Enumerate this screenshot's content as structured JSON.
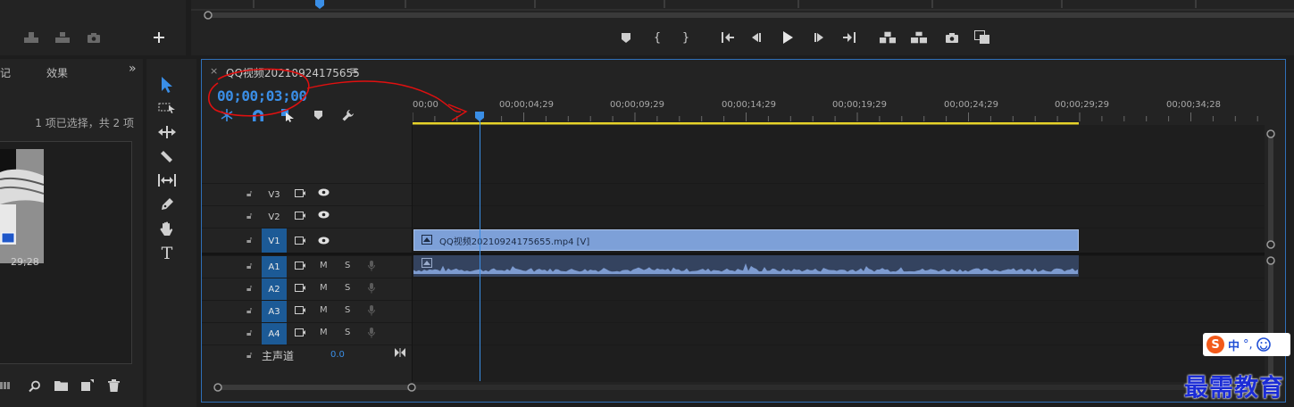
{
  "project_panel": {
    "tab_partial": "记",
    "tab_effects": "效果",
    "expand_glyph": "»",
    "selection_info": "1 项已选择，共 2 项",
    "thumb_duration": "29;28"
  },
  "timeline": {
    "close_glyph": "×",
    "sequence_title": "QQ视频20210924175655",
    "menu_glyph": "≡",
    "timecode": "00;00;03;00",
    "ruler_labels": [
      "00;00",
      "00;00;04;29",
      "00;00;09;29",
      "00;00;14;29",
      "00;00;19;29",
      "00;00;24;29",
      "00;00;29;29",
      "00;00;34;28"
    ],
    "video_tracks": [
      "V3",
      "V2",
      "V1"
    ],
    "audio_tracks": [
      "A1",
      "A2",
      "A3",
      "A4"
    ],
    "mute_label": "M",
    "solo_label": "S",
    "master_label": "主声道",
    "master_value": "0.0",
    "video_clip_label": "QQ视频20210924175655.mp4 [V]"
  },
  "watermark": {
    "ime_text": "中",
    "ime_punct": "°,",
    "brand_text": "最需教育"
  },
  "colors": {
    "accent": "#3a8ee6",
    "video_clip": "#7da0d8",
    "audio_clip": "#34435f",
    "work_area": "#e6d22a",
    "annotation": "#e01010"
  }
}
